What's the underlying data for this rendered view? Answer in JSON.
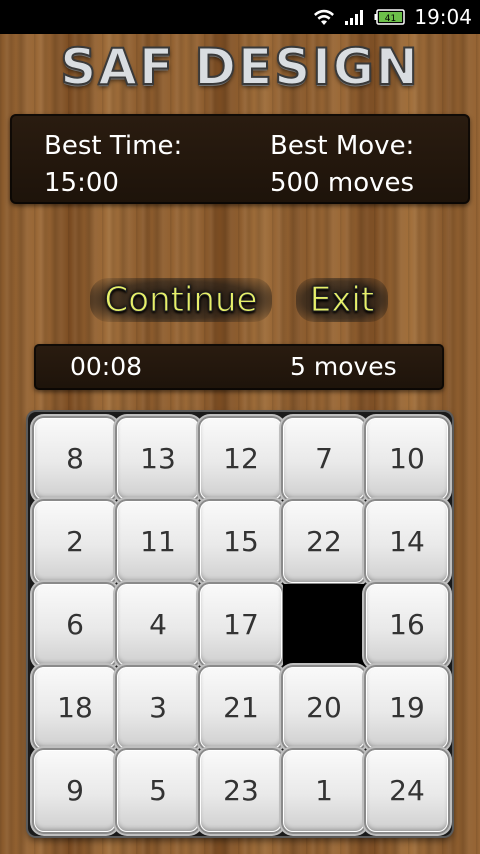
{
  "status_bar": {
    "battery_level": "41",
    "time": "19:04",
    "icons": [
      "wifi-icon",
      "signal-icon",
      "battery-icon"
    ]
  },
  "logo": {
    "text": "SAF DESIGN"
  },
  "best": {
    "time_label": "Best Time:",
    "time_value": "15:00",
    "move_label": "Best Move:",
    "move_value": "500  moves"
  },
  "buttons": {
    "continue": "Continue",
    "exit": "Exit"
  },
  "current": {
    "time": "00:08",
    "moves": "5 moves"
  },
  "board": {
    "rows": 5,
    "cols": 5,
    "tiles": [
      [
        "8",
        "13",
        "12",
        "7",
        "10"
      ],
      [
        "2",
        "11",
        "15",
        "22",
        "14"
      ],
      [
        "6",
        "4",
        "17",
        "",
        "16"
      ],
      [
        "18",
        "3",
        "21",
        "20",
        "19"
      ],
      [
        "9",
        "5",
        "23",
        "1",
        "24"
      ]
    ]
  },
  "colors": {
    "button_text": "#e7f06a",
    "panel_bg": "#1d130a",
    "tile_text": "#333333"
  }
}
